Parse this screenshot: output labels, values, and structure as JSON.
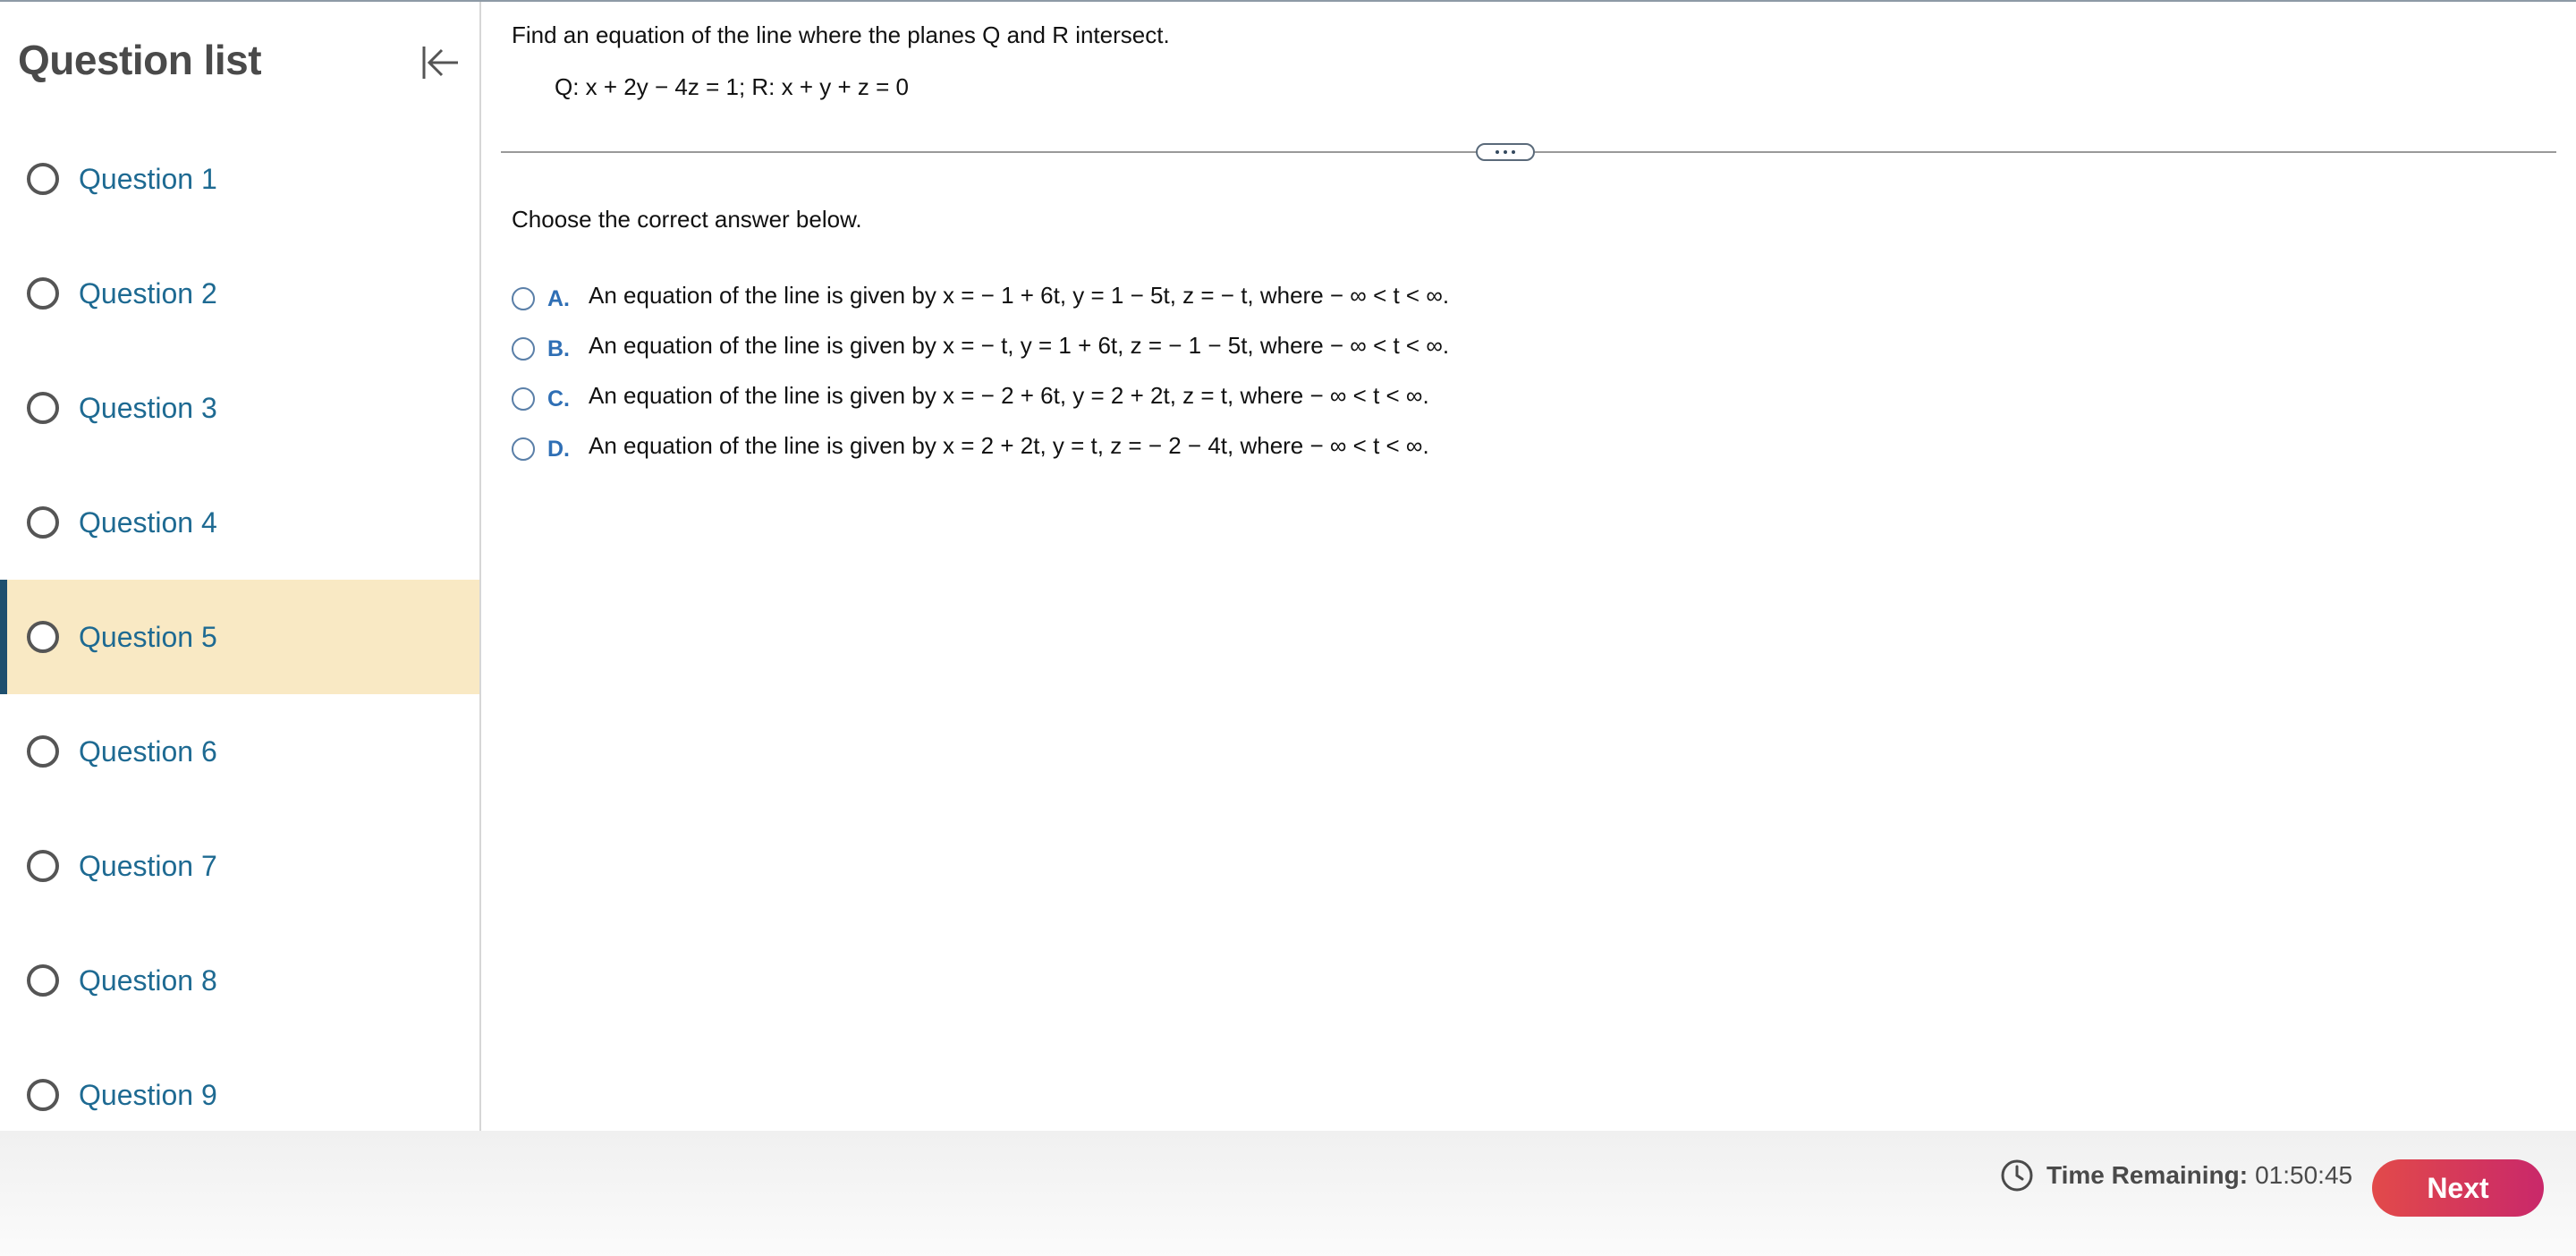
{
  "sidebar": {
    "title": "Question list",
    "items": [
      {
        "label": "Question 1"
      },
      {
        "label": "Question 2"
      },
      {
        "label": "Question 3"
      },
      {
        "label": "Question 4"
      },
      {
        "label": "Question 5"
      },
      {
        "label": "Question 6"
      },
      {
        "label": "Question 7"
      },
      {
        "label": "Question 8"
      },
      {
        "label": "Question 9"
      }
    ],
    "active_item": "Question 5"
  },
  "question": {
    "prompt": "Find an equation of the line where the planes Q and R intersect.",
    "equation": "Q: x + 2y − 4z = 1; R: x + y + z = 0",
    "instruction": "Choose the correct answer below.",
    "choices": [
      {
        "letter": "A.",
        "text": "An equation of the line is given by x = − 1 + 6t, y = 1 − 5t, z = − t, where  − ∞ < t < ∞."
      },
      {
        "letter": "B.",
        "text": "An equation of the line is given by x = − t, y = 1 + 6t, z = − 1 − 5t, where  − ∞ < t < ∞."
      },
      {
        "letter": "C.",
        "text": "An equation of the line is given by x = − 2 + 6t, y = 2 + 2t, z = t, where  − ∞ < t < ∞."
      },
      {
        "letter": "D.",
        "text": "An equation of the line is given by x = 2 + 2t, y = t, z = − 2 − 4t, where  − ∞ < t < ∞."
      }
    ]
  },
  "footer": {
    "timer_label": "Time Remaining:",
    "timer_value": "01:50:45",
    "next_label": "Next"
  },
  "colors": {
    "link": "#1e6a92",
    "active_bg": "#f9e9c4",
    "active_bar": "#1f4f6e",
    "choice_letter": "#2f6fb5",
    "next_start": "#e24a4a",
    "next_end": "#c9286a"
  },
  "icons": {
    "collapse": "collapse-left-icon",
    "clock": "clock-icon"
  }
}
